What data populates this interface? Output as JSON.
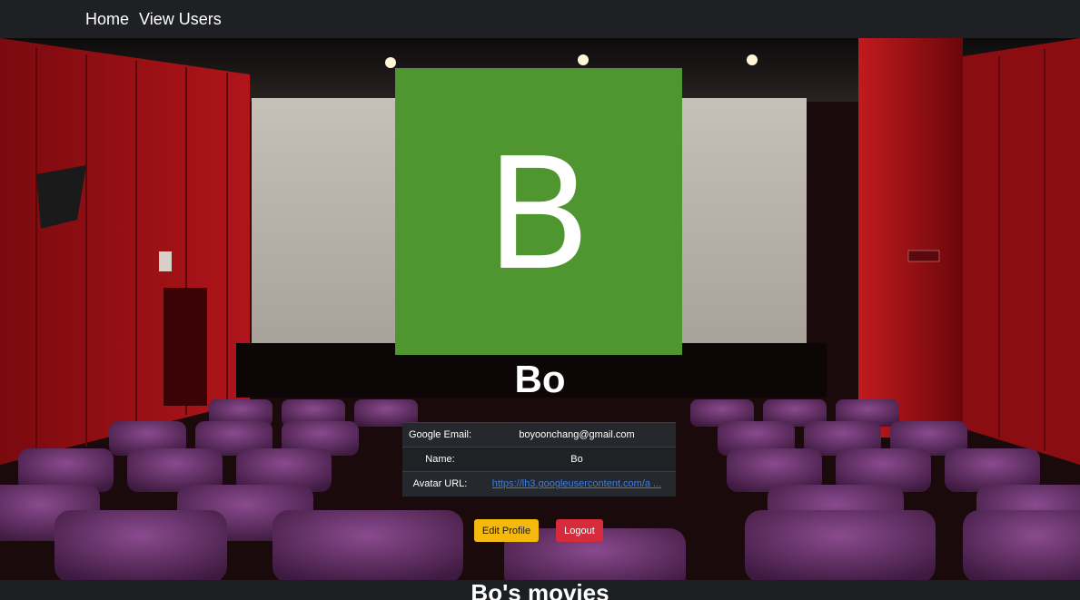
{
  "nav": {
    "home_label": "Home",
    "view_users_label": "View Users"
  },
  "profile": {
    "avatar_letter": "B",
    "avatar_color": "#4f9630",
    "name": "Bo"
  },
  "info": {
    "email_key": "Google Email:",
    "email_value": "boyoonchang@gmail.com",
    "name_key": "Name:",
    "name_value": "Bo",
    "avatar_key": "Avatar URL:",
    "avatar_value": "https://lh3.googleusercontent.com/a ..."
  },
  "buttons": {
    "edit_label": "Edit Profile",
    "logout_label": "Logout"
  },
  "movies": {
    "heading": "Bo's movies"
  },
  "colors": {
    "navbar": "#1e2023",
    "edit_button": "#f5b90d",
    "logout_button": "#d62b3b",
    "link": "#3b7ee8"
  }
}
